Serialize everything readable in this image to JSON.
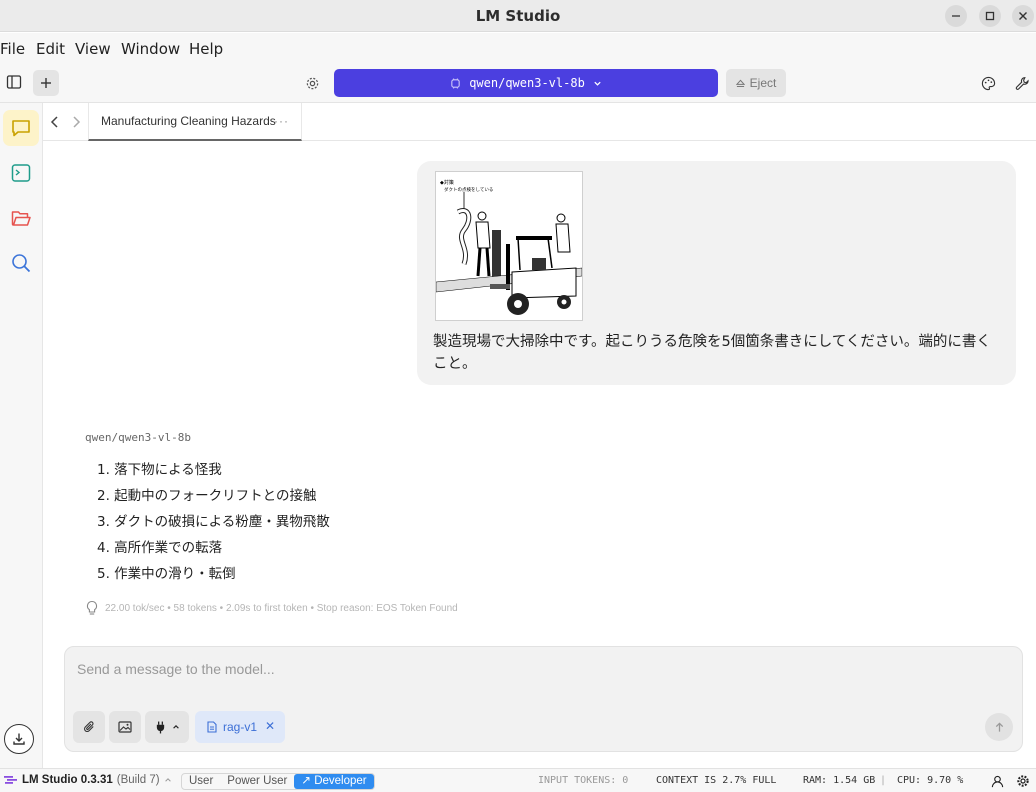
{
  "window": {
    "title": "LM Studio"
  },
  "menu": [
    "File",
    "Edit",
    "View",
    "Window",
    "Help"
  ],
  "toolbar": {
    "model_selected": "qwen/qwen3-vl-8b",
    "eject_label": "Eject"
  },
  "tab": {
    "title": "Manufacturing Cleaning Hazards",
    "more": "···"
  },
  "user_message": {
    "text": "製造現場で大掃除中です。起こりうる危険を5個箇条書きにしてください。端的に書くこと。",
    "image_caption": "◆対策\nダクトの点検をしている"
  },
  "assistant": {
    "model": "qwen/qwen3-vl-8b",
    "items": [
      "1. 落下物による怪我",
      "2. 起動中のフォークリフトとの接触",
      "3. ダクトの破損による粉塵・異物飛散",
      "4. 高所作業での転落",
      "5. 作業中の滑り・転倒"
    ],
    "stats": "22.00 tok/sec • 58 tokens • 2.09s to first token • Stop reason: EOS Token Found"
  },
  "composer": {
    "placeholder": "Send a message to the model...",
    "rag_label": "rag-v1"
  },
  "status": {
    "app": "LM Studio 0.3.31",
    "build": "(Build 7)",
    "modes": [
      "User",
      "Power User",
      "Developer"
    ],
    "active_mode": "Developer",
    "input_tokens": "INPUT TOKENS: 0",
    "context": "CONTEXT IS 2.7% FULL",
    "ram": "RAM: 1.54 GB",
    "cpu": "CPU: 9.70 %"
  },
  "colors": {
    "accent": "#4b3fe0",
    "active_rail": "#fdf3c9",
    "developer_mode": "#2f8cf0",
    "rag_chip": "#dfe8f9"
  }
}
